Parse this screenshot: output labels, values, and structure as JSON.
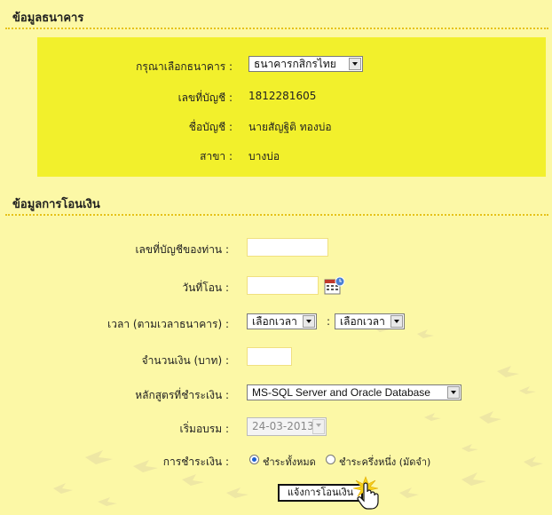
{
  "bank_section": {
    "title": "ข้อมูลธนาคาร",
    "select_label": "กรุณาเลือกธนาคาร :",
    "select_value": "ธนาคารกสิกรไทย",
    "account_no_label": "เลขที่บัญชี :",
    "account_no": "1812281605",
    "account_name_label": "ชื่อบัญชี :",
    "account_name": "นายสัญฐิติ ทองบ่อ",
    "branch_label": "สาขา :",
    "branch": "บางบ่อ"
  },
  "transfer_section": {
    "title": "ข้อมูลการโอนเงิน",
    "your_account_label": "เลขที่บัญชีของท่าน :",
    "your_account_value": "",
    "date_label": "วันที่โอน :",
    "date_value": "",
    "time_label": "เวลา (ตามเวลาธนาคาร) :",
    "time_hour": "เลือกเวลา",
    "time_sep": ":",
    "time_minute": "เลือกเวลา",
    "amount_label": "จำนวนเงิน (บาท) :",
    "amount_value": "",
    "course_label": "หลักสูตรที่ชำระเงิน :",
    "course_value": "MS-SQL Server and Oracle Database",
    "start_label": "เริ่มอบรม :",
    "start_value": "24-03-2013",
    "payment_label": "การชำระเงิน :",
    "payment_full": "ชำระทั้งหมด",
    "payment_half": "ชำระครึ่งหนึ่ง (มัดจำ)",
    "submit_label": "แจ้งการโอนเงิน"
  }
}
